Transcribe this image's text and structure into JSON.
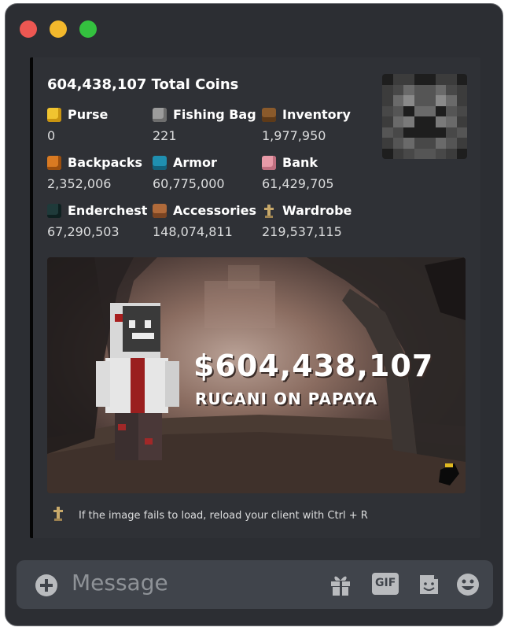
{
  "embed": {
    "title": "604,438,107 Total Coins",
    "fields": [
      {
        "name": "Purse",
        "value": "0",
        "icon": "gold-ingot-icon",
        "color": "#f0c430"
      },
      {
        "name": "Fishing Bag",
        "value": "221",
        "icon": "fishing-bag-icon",
        "color": "#9c9c9c"
      },
      {
        "name": "Inventory",
        "value": "1,977,950",
        "icon": "chest-icon",
        "color": "#8a5a2b"
      },
      {
        "name": "Backpacks",
        "value": "2,352,006",
        "icon": "backpack-icon",
        "color": "#d97a22"
      },
      {
        "name": "Armor",
        "value": "60,775,000",
        "icon": "chestplate-icon",
        "color": "#1f8fb0"
      },
      {
        "name": "Bank",
        "value": "61,429,705",
        "icon": "piggy-bank-icon",
        "color": "#e89aa8"
      },
      {
        "name": "Enderchest",
        "value": "67,290,503",
        "icon": "ender-chest-icon",
        "color": "#1f3a3a"
      },
      {
        "name": "Accessories",
        "value": "148,074,811",
        "icon": "accessory-bag-icon",
        "color": "#b06a3a"
      },
      {
        "name": "Wardrobe",
        "value": "219,537,115",
        "icon": "armor-stand-icon",
        "color": "#c8a96a"
      }
    ],
    "banner": {
      "amount": "$604,438,107",
      "player": "RUCANI ON PAPAYA"
    },
    "footer_text": "If the image fails to load, reload your client with Ctrl + R"
  },
  "composer": {
    "placeholder": "Message",
    "gif_label": "GIF"
  }
}
